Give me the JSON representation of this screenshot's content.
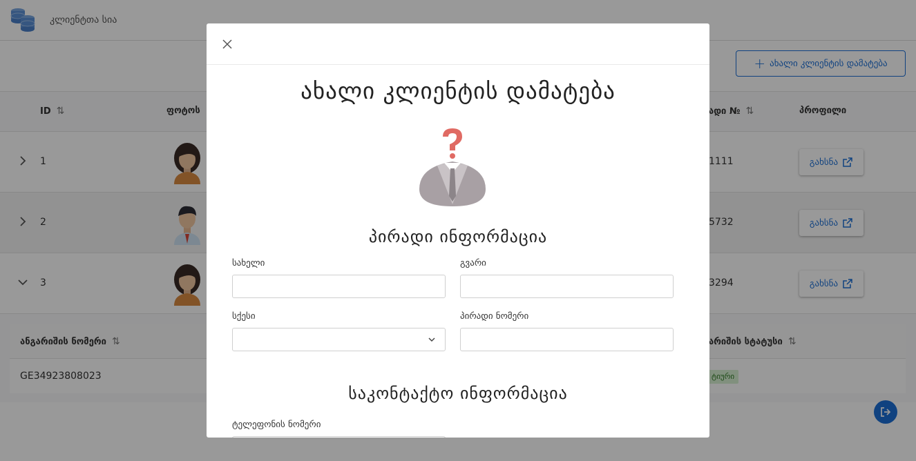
{
  "app": {
    "title": "კლიენტთა სია"
  },
  "toolbar": {
    "add_client_label": "ახალი კლიენტის დამატება"
  },
  "table": {
    "columns": {
      "id": "ID",
      "photo": "ფოტოს",
      "personal_number": "ადი №",
      "profile": "პროფილი"
    },
    "rows": [
      {
        "id": "1",
        "pn": "1111",
        "open_label": "გახსნა"
      },
      {
        "id": "2",
        "pn": "5732",
        "open_label": "გახსნა"
      },
      {
        "id": "3",
        "pn": "3294",
        "open_label": "გახსნა"
      }
    ]
  },
  "accounts": {
    "columns": {
      "account_number": "ანგარიშის ნომერი",
      "status": "არიშის სტატუსი"
    },
    "rows": [
      {
        "account_number": "GE34923808023",
        "status": "ტიური"
      }
    ]
  },
  "modal": {
    "title": "ახალი კლიენტის დამატება",
    "personal_section": "პირადი ინფორმაცია",
    "first_name_label": "სახელი",
    "last_name_label": "გვარი",
    "gender_label": "სქესი",
    "personal_number_label": "პირადი ნომერი",
    "contact_section": "საკონტაქტო ინფორმაცია",
    "phone_label": "ტელეფონის ნომერი"
  },
  "colors": {
    "accent": "#1c6fd6",
    "status_bg": "#d8f0d2",
    "status_fg": "#2f7a25"
  }
}
